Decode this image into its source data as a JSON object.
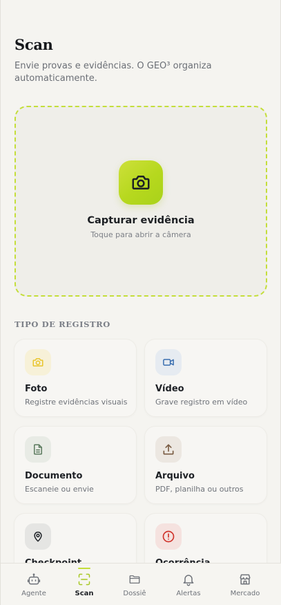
{
  "header": {
    "title": "Scan",
    "subtitle": "Envie provas e evidências. O GEO³ organiza automaticamente."
  },
  "capture": {
    "title": "Capturar evidência",
    "hint": "Toque para abrir a câmera",
    "icon": "camera-icon"
  },
  "section": {
    "label": "TIPO DE REGISTRO"
  },
  "cards": [
    {
      "name": "Foto",
      "desc": "Registre evidências visuais",
      "icon": "camera-icon",
      "color": "#e9c52c",
      "bg": "#f7f1d8"
    },
    {
      "name": "Vídeo",
      "desc": "Grave registro em vídeo",
      "icon": "video-icon",
      "color": "#3b6fb0",
      "bg": "#e6ebf1"
    },
    {
      "name": "Documento",
      "desc": "Escaneie ou envie",
      "icon": "document-icon",
      "color": "#5b7a5e",
      "bg": "#e8ebe5"
    },
    {
      "name": "Arquivo",
      "desc": "PDF, planilha ou outros",
      "icon": "upload-icon",
      "color": "#7a5c43",
      "bg": "#ece7e1"
    },
    {
      "name": "Checkpoint",
      "desc": "",
      "icon": "map-pin-icon",
      "color": "#1f2328",
      "bg": "#e5e5e3"
    },
    {
      "name": "Ocorrência",
      "desc": "",
      "icon": "alert-circle-icon",
      "color": "#d0342c",
      "bg": "#f5e2df"
    }
  ],
  "nav": {
    "items": [
      {
        "label": "Agente",
        "icon": "robot-icon"
      },
      {
        "label": "Scan",
        "icon": "scan-icon",
        "active": true
      },
      {
        "label": "Dossiê",
        "icon": "folder-icon"
      },
      {
        "label": "Alertas",
        "icon": "bell-icon"
      },
      {
        "label": "Mercado",
        "icon": "store-icon"
      }
    ]
  },
  "colors": {
    "accent": "#c4de3a",
    "background": "#f5f4f0"
  }
}
